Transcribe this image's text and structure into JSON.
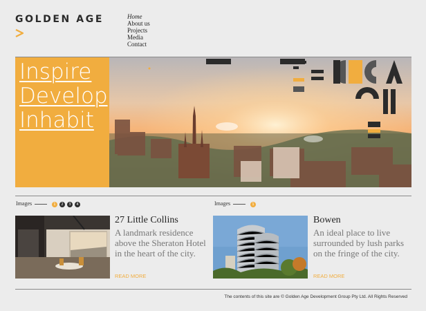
{
  "brand": {
    "logo_text": "GOLDEN AGE",
    "accent": "#f1ad3f"
  },
  "nav": {
    "items": [
      "Home",
      "About us",
      "Projects",
      "Media",
      "Contact"
    ],
    "active": "Home"
  },
  "hero": {
    "lines": [
      "Inspire",
      "Develop",
      "Inhabit"
    ]
  },
  "projects": [
    {
      "images_label": "Images",
      "pages": [
        "1",
        "2",
        "3",
        "4"
      ],
      "active_page": "1",
      "title": "27 Little Collins",
      "description": "A landmark residence above the Sheraton Hotel in the heart of the city.",
      "read_more": "READ MORE"
    },
    {
      "images_label": "Images",
      "pages": [
        "1"
      ],
      "active_page": "1",
      "title": "Bowen",
      "description": "An ideal place to live surrounded by lush parks on the fringe of the city.",
      "read_more": "READ MORE"
    }
  ],
  "footer": {
    "copyright": "The contents of this site are © Golden Age Development Group Pty Ltd. All Rights Reserved"
  }
}
